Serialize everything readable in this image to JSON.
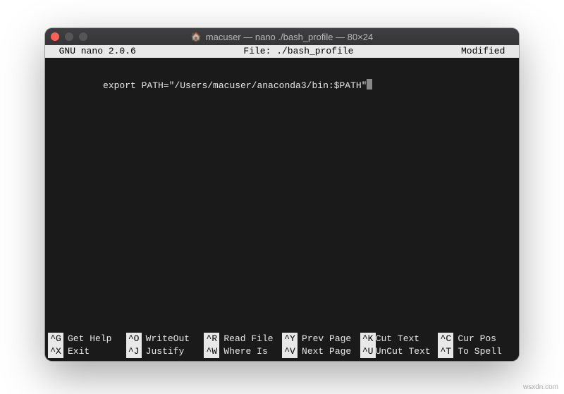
{
  "titlebar": {
    "icon": "home-icon",
    "title": "macuser — nano ./bash_profile — 80×24"
  },
  "infobar": {
    "left": "  GNU nano 2.0.6",
    "center": "File: ./bash_profile",
    "right": "Modified  "
  },
  "editor": {
    "lines": [
      "export PATH=\"/Users/macuser/anaconda3/bin:$PATH\""
    ]
  },
  "shortcuts": {
    "row1": [
      {
        "key": "^G",
        "label": "Get Help"
      },
      {
        "key": "^O",
        "label": "WriteOut"
      },
      {
        "key": "^R",
        "label": "Read File"
      },
      {
        "key": "^Y",
        "label": "Prev Page"
      },
      {
        "key": "^K",
        "label": "Cut Text"
      },
      {
        "key": "^C",
        "label": "Cur Pos"
      }
    ],
    "row2": [
      {
        "key": "^X",
        "label": "Exit"
      },
      {
        "key": "^J",
        "label": "Justify"
      },
      {
        "key": "^W",
        "label": "Where Is"
      },
      {
        "key": "^V",
        "label": "Next Page"
      },
      {
        "key": "^U",
        "label": "UnCut Text"
      },
      {
        "key": "^T",
        "label": "To Spell"
      }
    ]
  },
  "watermark": "wsxdn.com"
}
